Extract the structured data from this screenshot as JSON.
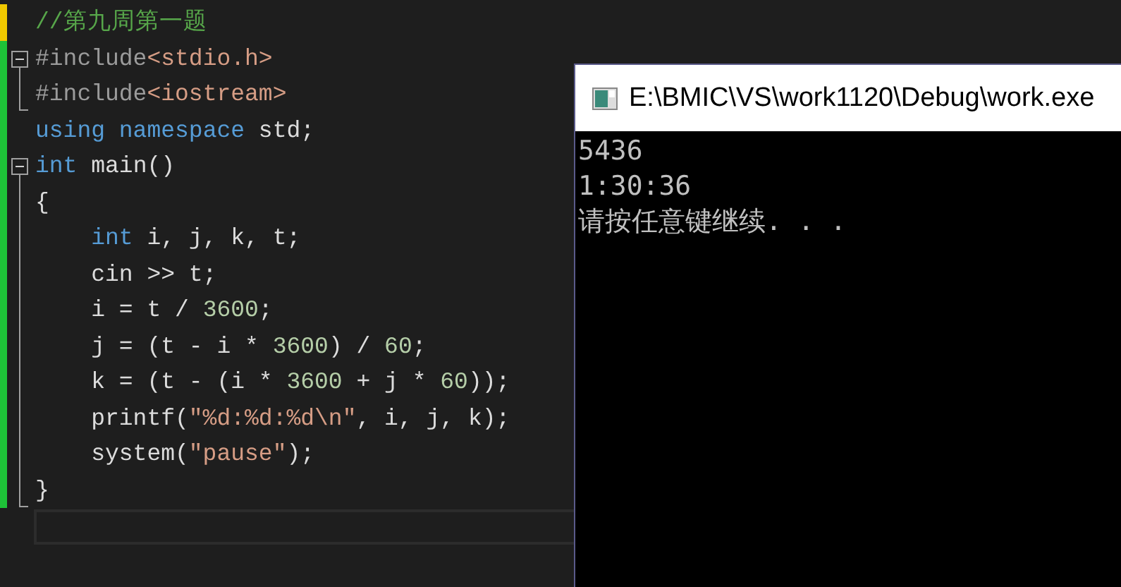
{
  "editor": {
    "blocks": [
      {
        "kind": "plain",
        "lines": [
          {
            "saved": false,
            "indent": false,
            "tokens": [
              {
                "kind": "comment",
                "text": "//第九周第一题"
              }
            ]
          }
        ]
      },
      {
        "kind": "fold",
        "expanded": true,
        "lines": [
          {
            "saved": true,
            "indent": false,
            "tokens": [
              {
                "kind": "preproc",
                "text": "#include"
              },
              {
                "kind": "string",
                "text": "<stdio.h>"
              }
            ]
          },
          {
            "saved": true,
            "indent": false,
            "tokens": [
              {
                "kind": "preproc",
                "text": "#include"
              },
              {
                "kind": "string",
                "text": "<iostream>"
              }
            ]
          }
        ]
      },
      {
        "kind": "plain",
        "lines": [
          {
            "saved": true,
            "indent": false,
            "tokens": [
              {
                "kind": "keyword",
                "text": "using namespace"
              },
              {
                "kind": "plain",
                "text": " std;"
              }
            ]
          }
        ]
      },
      {
        "kind": "fold",
        "expanded": true,
        "lines": [
          {
            "saved": true,
            "indent": false,
            "tokens": [
              {
                "kind": "keyword",
                "text": "int"
              },
              {
                "kind": "plain",
                "text": " main()"
              }
            ]
          },
          {
            "saved": true,
            "indent": false,
            "tokens": [
              {
                "kind": "plain",
                "text": "{"
              }
            ]
          },
          {
            "saved": true,
            "indent": true,
            "tokens": [
              {
                "kind": "keyword",
                "text": "int"
              },
              {
                "kind": "plain",
                "text": " i, j, k, t;"
              }
            ]
          },
          {
            "saved": true,
            "indent": true,
            "tokens": [
              {
                "kind": "plain",
                "text": "cin >> t;"
              }
            ]
          },
          {
            "saved": true,
            "indent": true,
            "tokens": [
              {
                "kind": "plain",
                "text": "i = t / "
              },
              {
                "kind": "number",
                "text": "3600"
              },
              {
                "kind": "plain",
                "text": ";"
              }
            ]
          },
          {
            "saved": true,
            "indent": true,
            "tokens": [
              {
                "kind": "plain",
                "text": "j = (t - i * "
              },
              {
                "kind": "number",
                "text": "3600"
              },
              {
                "kind": "plain",
                "text": ") / "
              },
              {
                "kind": "number",
                "text": "60"
              },
              {
                "kind": "plain",
                "text": ";"
              }
            ]
          },
          {
            "saved": true,
            "indent": true,
            "tokens": [
              {
                "kind": "plain",
                "text": "k = (t - (i * "
              },
              {
                "kind": "number",
                "text": "3600"
              },
              {
                "kind": "plain",
                "text": " + j * "
              },
              {
                "kind": "number",
                "text": "60"
              },
              {
                "kind": "plain",
                "text": "));"
              }
            ]
          },
          {
            "saved": true,
            "indent": true,
            "tokens": [
              {
                "kind": "plain",
                "text": "printf("
              },
              {
                "kind": "string",
                "text": "\"%d:%d:%d\\n\""
              },
              {
                "kind": "plain",
                "text": ", i, j, k);"
              }
            ]
          },
          {
            "saved": true,
            "indent": true,
            "tokens": [
              {
                "kind": "plain",
                "text": "system("
              },
              {
                "kind": "string",
                "text": "\"pause\""
              },
              {
                "kind": "plain",
                "text": ");"
              }
            ]
          },
          {
            "saved": true,
            "indent": false,
            "tokens": [
              {
                "kind": "plain",
                "text": "}"
              }
            ]
          }
        ]
      }
    ]
  },
  "console": {
    "title": "E:\\BMIC\\VS\\work1120\\Debug\\work.exe",
    "output": [
      "5436",
      "1:30:36",
      "请按任意键继续. . ."
    ]
  }
}
